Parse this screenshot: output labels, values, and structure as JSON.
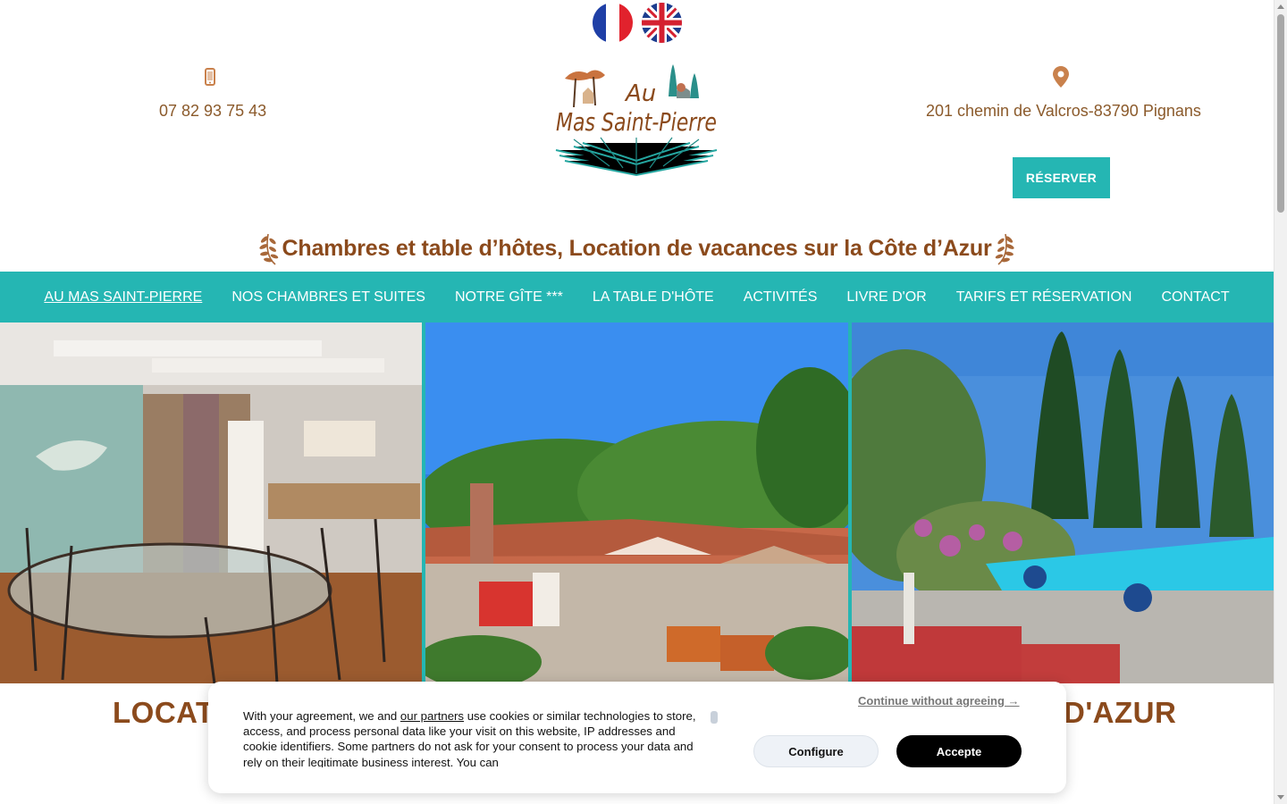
{
  "header": {
    "phone": "07 82 93 75 43",
    "address": "201 chemin de Valcros-83790 Pignans",
    "reserve_label": "RÉSERVER",
    "logo_line1": "Au",
    "logo_line2": "Mas Saint-Pierre",
    "tagline": "Chambres et table d’hôtes, Location de vacances sur la Côte d’Azur"
  },
  "languages": [
    "fr",
    "en"
  ],
  "nav": {
    "items": [
      {
        "label": "AU MAS SAINT-PIERRE",
        "active": true
      },
      {
        "label": "NOS CHAMBRES ET SUITES",
        "active": false
      },
      {
        "label": "NOTRE GÎTE ***",
        "active": false
      },
      {
        "label": "LA TABLE D'HÔTE",
        "active": false
      },
      {
        "label": "ACTIVITÉS",
        "active": false
      },
      {
        "label": "LIVRE D'OR",
        "active": false
      },
      {
        "label": "TARIFS ET RÉSERVATION",
        "active": false
      },
      {
        "label": "CONTACT",
        "active": false
      }
    ]
  },
  "section": {
    "title_left_visible": "LOCATI",
    "title_right_visible": "D'AZUR"
  },
  "cookie": {
    "text_before": "With your agreement, we and ",
    "partners_link": "our partners",
    "text_after": " use cookies or similar technologies to store, access, and process personal data like your visit on this website, IP addresses and cookie identifiers. Some partners do not ask for your consent to process your data and rely on their legitimate business interest. You can",
    "continue_label": "Continue without agreeing →",
    "configure_label": "Configure",
    "accept_label": "Accepte"
  },
  "colors": {
    "brand_teal": "#25b6b3",
    "brand_brown": "#8b4a1c",
    "accent_orange": "#c9814c"
  }
}
